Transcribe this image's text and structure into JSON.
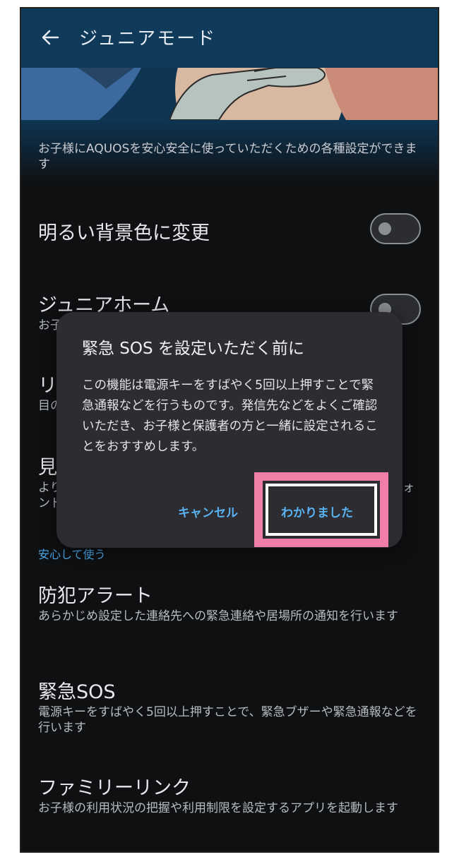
{
  "appbar": {
    "title": "ジュニアモード",
    "back_icon": "arrow-left-icon"
  },
  "description": "お子様にAQUOSを安心安全に使っていただくための各種設定ができます",
  "items": [
    {
      "title": "明るい背景色に変更",
      "subtitle": ""
    },
    {
      "title": "ジュニアホーム",
      "subtitle": "お子"
    },
    {
      "title": "リ",
      "subtitle": "目の"
    },
    {
      "title": "見",
      "subtitle": "より\nンド",
      "tail": "ォ"
    }
  ],
  "section_label": "安心して使う",
  "safety_items": [
    {
      "title": "防犯アラート",
      "subtitle": "あらかじめ設定した連絡先への緊急連絡や居場所の通知を行います"
    },
    {
      "title": "緊急SOS",
      "subtitle": "電源キーをすばやく5回以上押すことで、緊急ブザーや緊急通報などを行います"
    },
    {
      "title": "ファミリーリンク",
      "subtitle": "お子様の利用状況の把握や利用制限を設定するアプリを起動します"
    }
  ],
  "dialog": {
    "title": "緊急 SOS を設定いただく前に",
    "body": "この機能は電源キーをすばやく5回以上押すことで緊急通報などを行うものです。発信先などをよくご確認いただき、お子様と保護者の方と一緒に設定されることをおすすめします。",
    "cancel_label": "キャンセル",
    "ok_label": "わかりました"
  },
  "colors": {
    "accent": "#59b3f2",
    "highlight": "#f07fa7",
    "appbar": "#103a5a"
  }
}
